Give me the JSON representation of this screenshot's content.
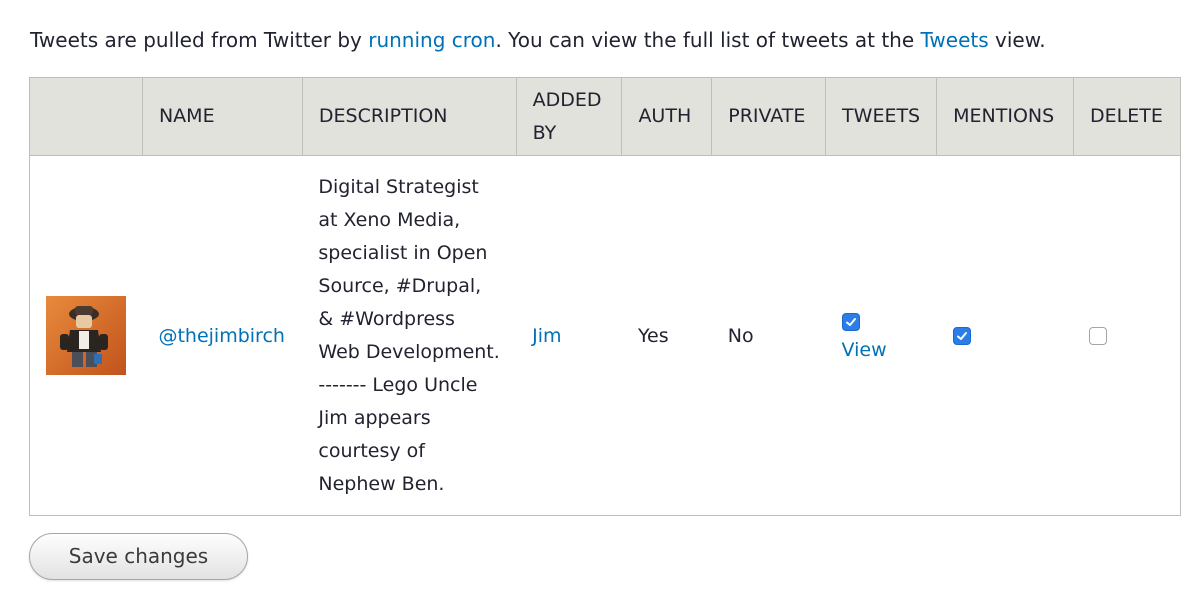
{
  "intro": {
    "text_before": "Tweets are pulled from Twitter by ",
    "cron_link": "running cron",
    "text_middle": ". You can view the full list of tweets at the ",
    "tweets_link": "Tweets",
    "text_after": " view."
  },
  "table": {
    "headers": [
      "",
      "NAME",
      "DESCRIPTION",
      "ADDED BY",
      "AUTH",
      "PRIVATE",
      "TWEETS",
      "MENTIONS",
      "DELETE"
    ],
    "rows": [
      {
        "avatar_icon": "lego-figure-avatar",
        "name": "@thejimbirch",
        "description": "Digital Strategist at Xeno Media, specialist in Open Source, #Drupal, & #Wordpress Web Development. ------- Lego Uncle Jim appears courtesy of Nephew Ben.",
        "added_by": "Jim",
        "auth": "Yes",
        "private": "No",
        "tweets_checked": true,
        "tweets_link": "View",
        "mentions_checked": true,
        "delete_checked": false
      }
    ]
  },
  "actions": {
    "save_label": "Save changes"
  },
  "colors": {
    "link": "#0071b8",
    "header_bg": "#e1e2dc",
    "checkbox_checked": "#2b7de9"
  }
}
